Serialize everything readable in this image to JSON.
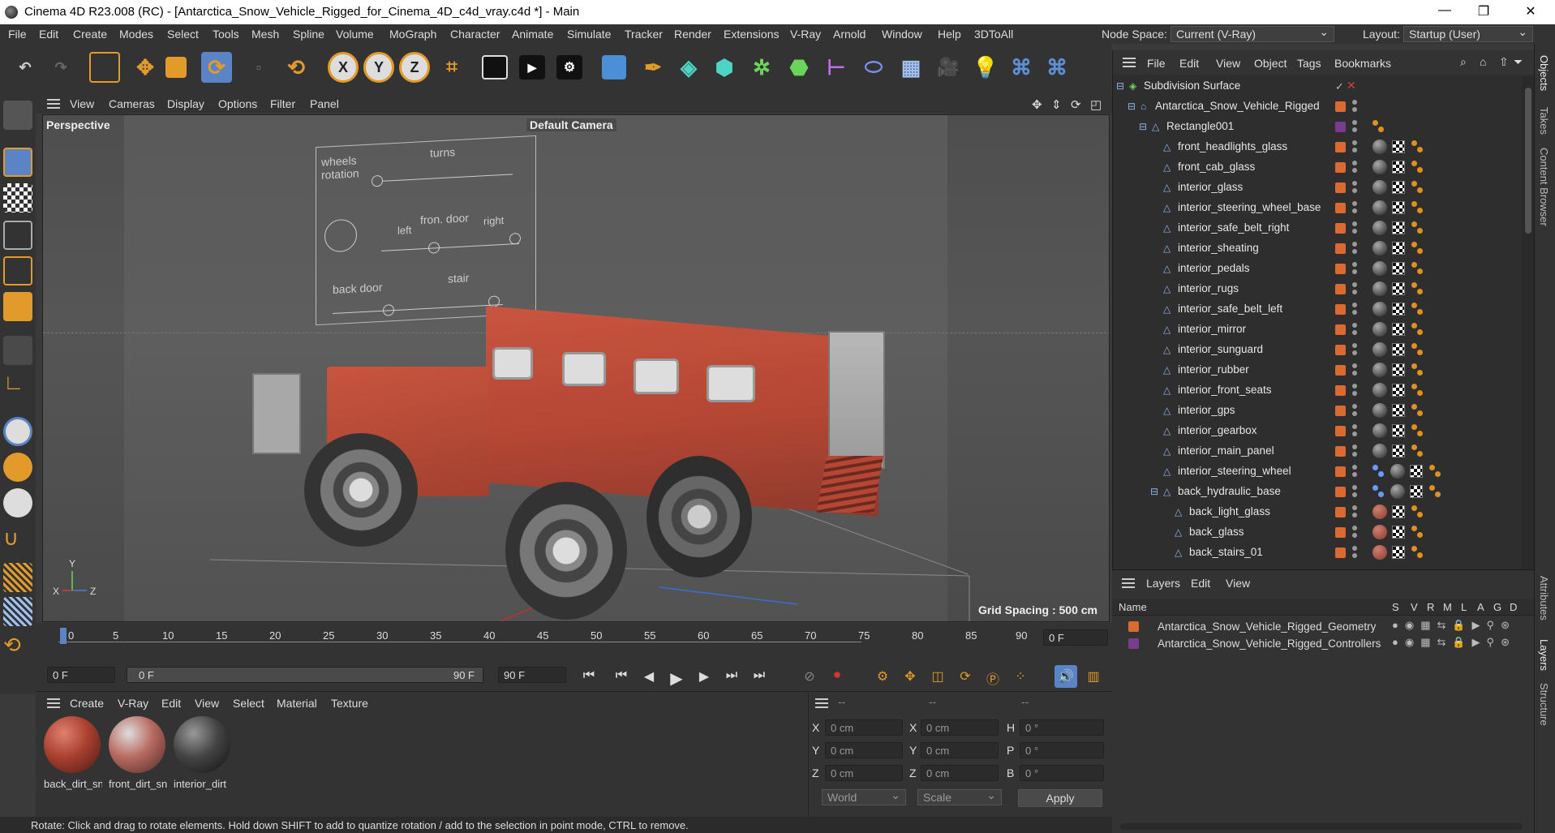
{
  "titlebar": {
    "title": "Cinema 4D R23.008 (RC) - [Antarctica_Snow_Vehicle_Rigged_for_Cinema_4D_c4d_vray.c4d *] - Main",
    "minimize": "—",
    "maximize": "❐",
    "close": "✕"
  },
  "menubar": {
    "items": [
      "File",
      "Edit",
      "Create",
      "Modes",
      "Select",
      "Tools",
      "Mesh",
      "Spline",
      "Volume",
      "MoGraph",
      "Character",
      "Animate",
      "Simulate",
      "Tracker",
      "Render",
      "Extensions",
      "V-Ray",
      "Arnold",
      "Window",
      "Help",
      "3DToAll"
    ],
    "node_space_label": "Node Space:",
    "node_space_value": "Current (V-Ray)",
    "layout_label": "Layout:",
    "layout_value": "Startup (User)"
  },
  "toolbar": {
    "axis_x": "X",
    "axis_y": "Y",
    "axis_z": "Z"
  },
  "viewport": {
    "menu": [
      "View",
      "Cameras",
      "Display",
      "Options",
      "Filter",
      "Panel"
    ],
    "label": "Perspective",
    "camera": "Default Camera",
    "grid_spacing": "Grid Spacing : 500 cm",
    "rig_board": {
      "wheels_rotation": "wheels rotation",
      "turns": "turns",
      "left": "left",
      "front_door": "fron. door",
      "right": "right",
      "back_door": "back door",
      "stair": "stair"
    },
    "axis_y": "Y",
    "axis_x": "X",
    "axis_z": "Z"
  },
  "timeline": {
    "ticks": [
      "0",
      "5",
      "10",
      "15",
      "20",
      "25",
      "30",
      "35",
      "40",
      "45",
      "50",
      "55",
      "60",
      "65",
      "70",
      "75",
      "80",
      "85",
      "90"
    ],
    "current_frame": "0 F"
  },
  "playbar": {
    "start": "0 F",
    "range_start": "0 F",
    "range_end": "90 F",
    "end": "90 F"
  },
  "materials": {
    "menu": [
      "Create",
      "V-Ray",
      "Edit",
      "View",
      "Select",
      "Material",
      "Texture"
    ],
    "items": [
      {
        "name": "back_dirt_sn"
      },
      {
        "name": "front_dirt_sn"
      },
      {
        "name": "interior_dirt"
      }
    ]
  },
  "coords": {
    "headers": [
      "--",
      "--",
      "--"
    ],
    "rows": [
      {
        "a": "X",
        "av": "0 cm",
        "b": "X",
        "bv": "0 cm",
        "c": "H",
        "cv": "0 °"
      },
      {
        "a": "Y",
        "av": "0 cm",
        "b": "Y",
        "bv": "0 cm",
        "c": "P",
        "cv": "0 °"
      },
      {
        "a": "Z",
        "av": "0 cm",
        "b": "Z",
        "bv": "0 cm",
        "c": "B",
        "cv": "0 °"
      }
    ],
    "mode1": "World",
    "mode2": "Scale",
    "apply": "Apply"
  },
  "objects": {
    "menu": [
      "File",
      "Edit",
      "View",
      "Object",
      "Tags",
      "Bookmarks"
    ],
    "rows": [
      {
        "name": "Subdivision Surface",
        "level": 0
      },
      {
        "name": "Antarctica_Snow_Vehicle_Rigged",
        "level": 1
      },
      {
        "name": "Rectangle001",
        "level": 2
      },
      {
        "name": "front_headlights_glass",
        "level": 3
      },
      {
        "name": "front_cab_glass",
        "level": 3
      },
      {
        "name": "interior_glass",
        "level": 3
      },
      {
        "name": "interior_steering_wheel_base",
        "level": 3
      },
      {
        "name": "interior_safe_belt_right",
        "level": 3
      },
      {
        "name": "interior_sheating",
        "level": 3
      },
      {
        "name": "interior_pedals",
        "level": 3
      },
      {
        "name": "interior_rugs",
        "level": 3
      },
      {
        "name": "interior_safe_belt_left",
        "level": 3
      },
      {
        "name": "interior_mirror",
        "level": 3
      },
      {
        "name": "interior_sunguard",
        "level": 3
      },
      {
        "name": "interior_rubber",
        "level": 3
      },
      {
        "name": "interior_front_seats",
        "level": 3
      },
      {
        "name": "interior_gps",
        "level": 3
      },
      {
        "name": "interior_gearbox",
        "level": 3
      },
      {
        "name": "interior_main_panel",
        "level": 3
      },
      {
        "name": "interior_steering_wheel",
        "level": 3
      },
      {
        "name": "back_hydraulic_base",
        "level": 3
      },
      {
        "name": "back_light_glass",
        "level": 4
      },
      {
        "name": "back_glass",
        "level": 4
      },
      {
        "name": "back_stairs_01",
        "level": 4
      }
    ]
  },
  "layers": {
    "menu": [
      "Layers",
      "Edit",
      "View"
    ],
    "name_header": "Name",
    "cols": [
      "S",
      "V",
      "R",
      "M",
      "L",
      "A",
      "G",
      "D"
    ],
    "rows": [
      {
        "name": "Antarctica_Snow_Vehicle_Rigged_Geometry",
        "color": "#d96a32"
      },
      {
        "name": "Antarctica_Snow_Vehicle_Rigged_Controllers",
        "color": "#7a3c8c"
      }
    ]
  },
  "righttabs": [
    "Objects",
    "Takes",
    "Content Browser",
    "Attributes",
    "Layers",
    "Structure"
  ],
  "status": "Rotate: Click and drag to rotate elements. Hold down SHIFT to add to quantize rotation / add to the selection in point mode, CTRL to remove."
}
